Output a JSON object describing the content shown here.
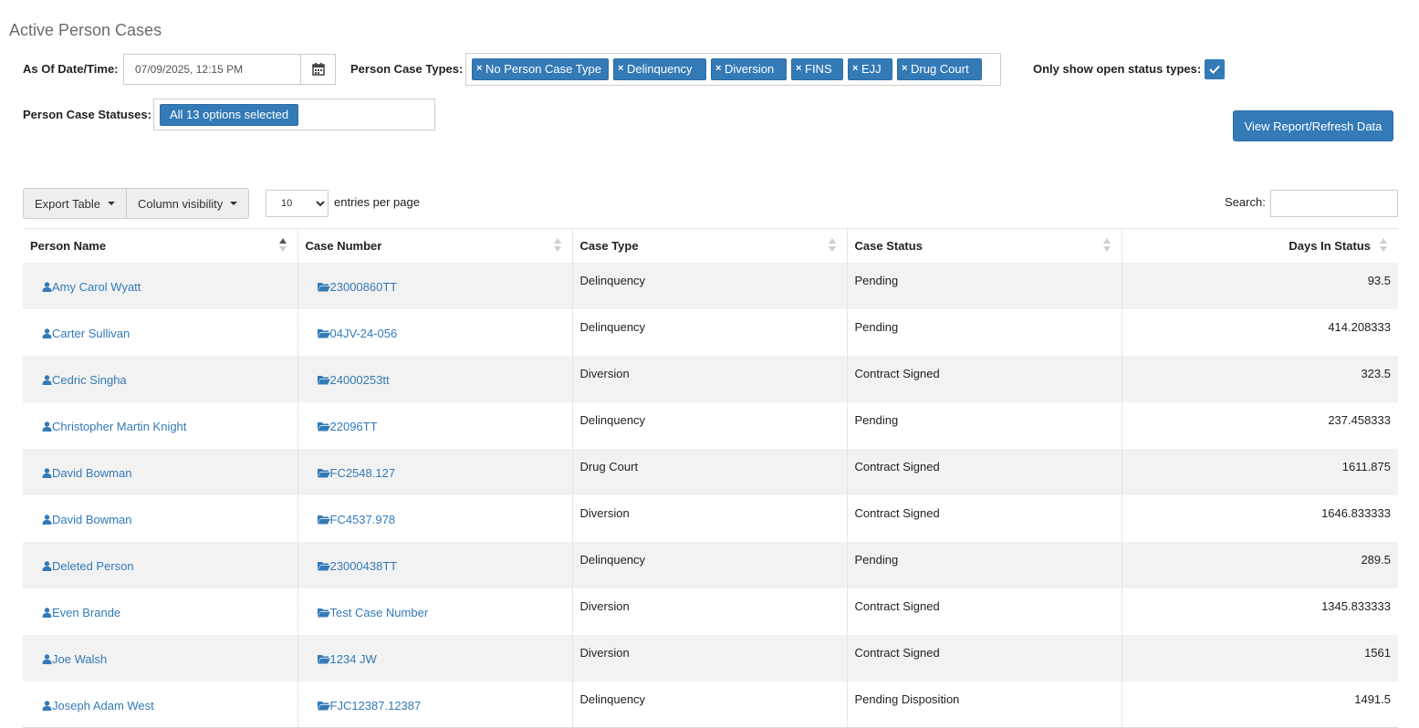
{
  "page": {
    "title": "Active Person Cases"
  },
  "filters": {
    "as_of_label": "As Of Date/Time:",
    "as_of_value": "07/09/2025, 12:15 PM",
    "case_types_label": "Person Case Types:",
    "case_types": [
      "No Person Case Type",
      "Delinquency",
      "Diversion",
      "FINS",
      "EJJ",
      "Drug Court"
    ],
    "open_only_label": "Only show open status types:",
    "open_only_checked": true,
    "statuses_label": "Person Case Statuses:",
    "statuses_value": "All 13 options selected"
  },
  "actions": {
    "view_report": "View Report/Refresh Data"
  },
  "toolbar": {
    "export_label": "Export Table",
    "column_visibility_label": "Column visibility",
    "entries_value": "10",
    "entries_label": "entries per page",
    "search_label": "Search:",
    "search_value": ""
  },
  "table": {
    "columns": [
      "Person Name",
      "Case Number",
      "Case Type",
      "Case Status",
      "Days In Status"
    ],
    "rows": [
      {
        "person": "Amy Carol Wyatt",
        "case_number": "23000860TT",
        "case_type": "Delinquency",
        "status": "Pending",
        "days": "93.5"
      },
      {
        "person": "Carter Sullivan",
        "case_number": "04JV-24-056",
        "case_type": "Delinquency",
        "status": "Pending",
        "days": "414.208333"
      },
      {
        "person": "Cedric Singha",
        "case_number": "24000253tt",
        "case_type": "Diversion",
        "status": "Contract Signed",
        "days": "323.5"
      },
      {
        "person": "Christopher Martin Knight",
        "case_number": "22096TT",
        "case_type": "Delinquency",
        "status": "Pending",
        "days": "237.458333"
      },
      {
        "person": "David Bowman",
        "case_number": "FC2548.127",
        "case_type": "Drug Court",
        "status": "Contract Signed",
        "days": "1611.875"
      },
      {
        "person": "David Bowman",
        "case_number": "FC4537.978",
        "case_type": "Diversion",
        "status": "Contract Signed",
        "days": "1646.833333"
      },
      {
        "person": "Deleted Person",
        "case_number": "23000438TT",
        "case_type": "Delinquency",
        "status": "Pending",
        "days": "289.5"
      },
      {
        "person": "Even Brande",
        "case_number": "Test Case Number",
        "case_type": "Diversion",
        "status": "Contract Signed",
        "days": "1345.833333"
      },
      {
        "person": "Joe Walsh",
        "case_number": "1234 JW",
        "case_type": "Diversion",
        "status": "Contract Signed",
        "days": "1561"
      },
      {
        "person": "Joseph Adam West",
        "case_number": "FJC12387.12387",
        "case_type": "Delinquency",
        "status": "Pending Disposition",
        "days": "1491.5"
      }
    ]
  },
  "icons": {
    "calendar": "calendar-icon",
    "person": "user-icon",
    "case": "folder-open-icon",
    "remove": "close-icon",
    "check": "check-icon"
  },
  "colors": {
    "accent": "#337ab7",
    "row_stripe": "#f2f2f2"
  }
}
